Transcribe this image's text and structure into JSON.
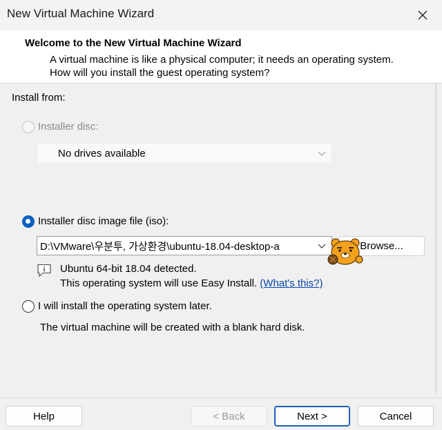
{
  "window": {
    "title": "New Virtual Machine Wizard"
  },
  "header": {
    "title": "Welcome to the New Virtual Machine Wizard",
    "description": "A virtual machine is like a physical computer; it needs an operating system. How will you install the guest operating system?"
  },
  "install": {
    "heading": "Install from:",
    "disc_option": {
      "label": "Installer disc:",
      "selected": false,
      "enabled": false
    },
    "disc_dropdown": {
      "value": "No drives available",
      "enabled": false
    },
    "iso_option": {
      "label": "Installer disc image file (iso):",
      "selected": true
    },
    "iso_path": {
      "value": "D:\\VMware\\우분투, 가상환경\\ubuntu-18.04-desktop-a"
    },
    "browse_label": "Browse...",
    "detected_text": "Ubuntu 64-bit 18.04 detected.",
    "easy_install_text": "This operating system will use Easy Install.",
    "whats_this_link": "(What's this?)",
    "later_option": {
      "label": "I will install the operating system later.",
      "selected": false
    },
    "later_note": "The virtual machine will be created with a blank hard disk."
  },
  "footer": {
    "help_label": "Help",
    "back_label": "< Back",
    "next_label": "Next >",
    "cancel_label": "Cancel"
  },
  "colors": {
    "accent": "#0a5fc1",
    "link": "#0645ad",
    "sticker": "#f5a11c"
  },
  "icons": [
    "close-icon",
    "chevron-down-icon",
    "info-icon",
    "bear-sticker-icon"
  ]
}
